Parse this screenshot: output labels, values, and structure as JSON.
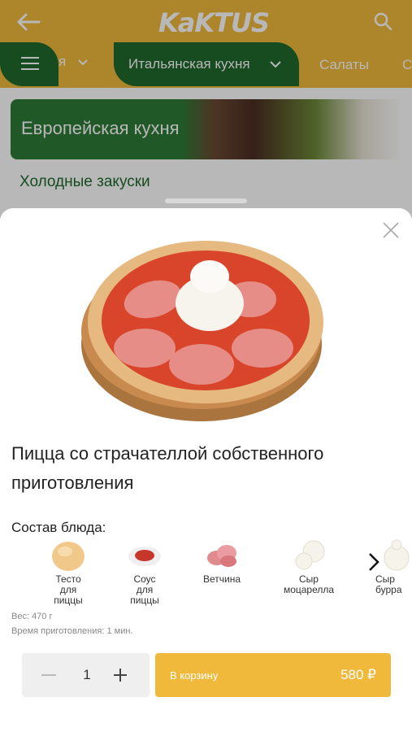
{
  "app": {
    "logo": "KaKTUS"
  },
  "categories": [
    {
      "label": "я"
    },
    {
      "label": "Итальянская кухня"
    },
    {
      "label": "Салаты"
    },
    {
      "label": "С"
    }
  ],
  "background": {
    "banner_title": "Европейская кухня",
    "section_title": "Холодные закуски"
  },
  "dish": {
    "title": "Пицца со страчателлой собственного приготовления",
    "composition_label": "Состав блюда:",
    "ingredients": [
      {
        "name": "Тесто\nдля\nпиццы",
        "icon": "dough-icon"
      },
      {
        "name": "Соус\nдля\nпиццы",
        "icon": "sauce-icon"
      },
      {
        "name": "Ветчина",
        "icon": "ham-icon"
      },
      {
        "name": "Сыр\nмоцарелла",
        "icon": "mozzarella-icon"
      },
      {
        "name": "Сыр\nбурра",
        "icon": "burrata-icon"
      }
    ],
    "weight": "Вес: 470 г",
    "cook_time": "Время приготовления: 1 мин.",
    "quantity": "1",
    "cart_label": "В корзину",
    "price": "580 ₽"
  },
  "colors": {
    "brand_yellow": "#f0b93c",
    "brand_green": "#1f6a2c"
  }
}
